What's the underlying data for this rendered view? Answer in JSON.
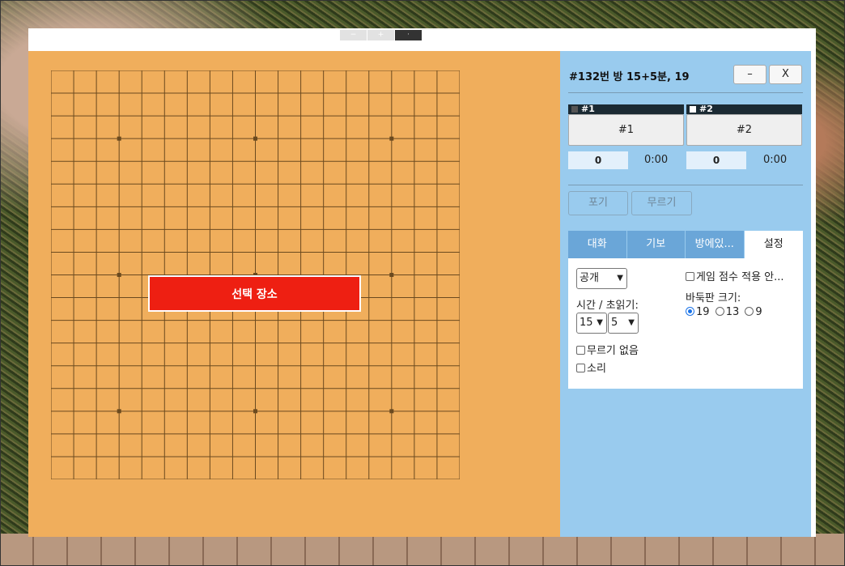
{
  "zoom": {
    "minus": "−",
    "plus": "+",
    "extra": "·"
  },
  "board": {
    "size": 19,
    "banner": "선택 장소"
  },
  "room": {
    "title": "#132번 방   15+5분, 19",
    "minimize_label": "–",
    "close_label": "X"
  },
  "players": [
    {
      "header": "#1",
      "name": "#1",
      "score": "0",
      "time": "0:00",
      "stone_color": "#555555"
    },
    {
      "header": "#2",
      "name": "#2",
      "score": "0",
      "time": "0:00",
      "stone_color": "#ffffff"
    }
  ],
  "actions": {
    "resign": "포기",
    "undo": "무르기"
  },
  "tabs": [
    {
      "label": "대화"
    },
    {
      "label": "기보"
    },
    {
      "label": "방에있..."
    },
    {
      "label": "설정"
    }
  ],
  "settings": {
    "visibility": "공개",
    "time_label": "시간 / 초읽기:",
    "time_minutes": "15",
    "byoyomi": "5",
    "no_undo_label": "무르기 없음",
    "sound_label": "소리",
    "no_score_label": "게임 점수 적용 안...",
    "board_size_label": "바둑판 크기:",
    "size_options": [
      "19",
      "13",
      "9"
    ],
    "selected_size": "19"
  }
}
